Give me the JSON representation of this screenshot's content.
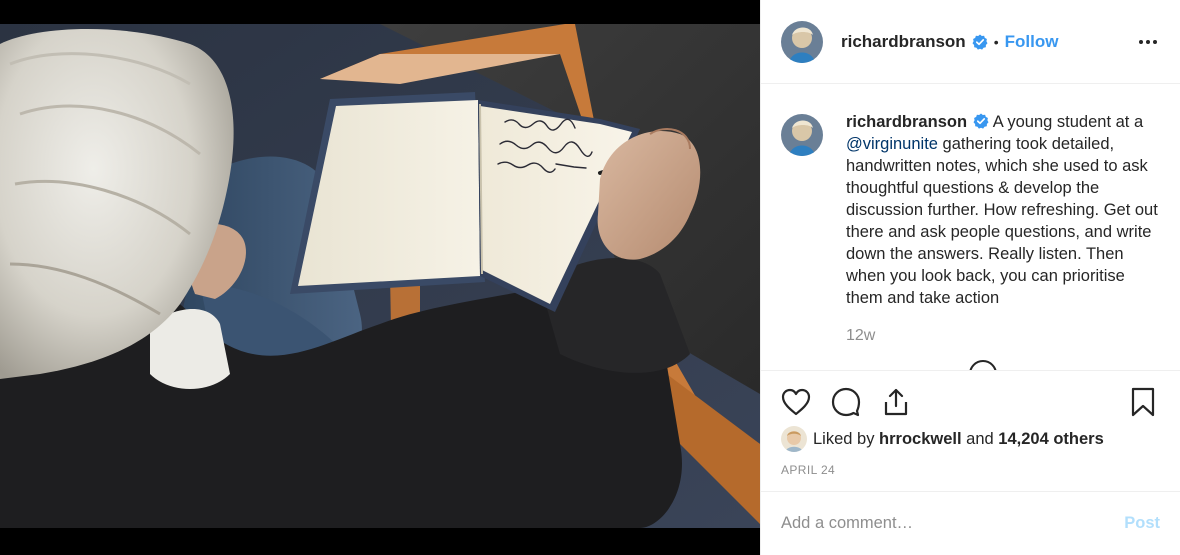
{
  "post": {
    "username": "richardbranson",
    "verified": true,
    "separator": "•",
    "follow_label": "Follow",
    "caption_user": "richardbranson",
    "caption_before": " A young student at a ",
    "caption_mention": "@virginunite",
    "caption_after": " gathering took detailed, handwritten notes, which she used to ask thoughtful questions & develop the discussion further. How refreshing. Get out there and ask people questions, and write down the answers. Really listen. Then when you look back, you can prioritise them and take action",
    "time_ago": "12w",
    "likes_prefix": "Liked by ",
    "liked_by_user": "hrrockwell",
    "likes_middle": " and ",
    "likes_count": "14,204 others",
    "date": "APRIL 24",
    "comment_placeholder": "Add a comment…",
    "post_label": "Post"
  },
  "icons": {
    "verified": "verified-badge-icon",
    "more": "more-options-icon",
    "like": "heart-icon",
    "comment": "comment-icon",
    "share": "share-icon",
    "save": "bookmark-icon"
  },
  "colors": {
    "link_blue": "#3897f0",
    "mention_blue": "#003569",
    "muted": "#8e8e8e",
    "post_disabled": "#b2dffc"
  }
}
